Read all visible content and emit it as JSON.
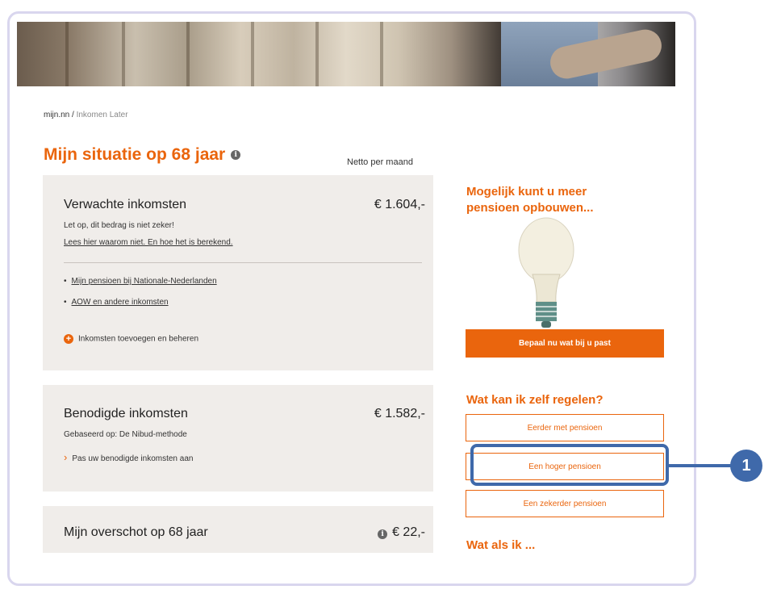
{
  "breadcrumb": {
    "root": "mijn.nn",
    "separator": " / ",
    "current": "Inkomen Later"
  },
  "page": {
    "title": "Mijn situatie op 68 jaar",
    "column_label": "Netto per maand"
  },
  "expected_income": {
    "title": "Verwachte inkomsten",
    "amount": "€ 1.604,-",
    "note": "Let op, dit bedrag is niet zeker!",
    "explain_link": "Lees hier waarom niet. En hoe het is berekend.",
    "links": [
      "Mijn pensioen bij Nationale-Nederlanden",
      "AOW en andere inkomsten"
    ],
    "add_label": "Inkomsten toevoegen en beheren"
  },
  "needed_income": {
    "title": "Benodigde inkomsten",
    "amount": "€ 1.582,-",
    "basis": "Gebaseerd op: De Nibud-methode",
    "adjust_link": "Pas uw benodigde inkomsten aan"
  },
  "surplus": {
    "title": "Mijn overschot op 68 jaar",
    "amount": "€ 22,-"
  },
  "sidebar": {
    "promo_heading": "Mogelijk kunt u meer pensioen opbouwen...",
    "cta_label": "Bepaal nu wat bij u past",
    "regelen_heading": "Wat kan ik zelf regelen?",
    "options": [
      "Eerder met pensioen",
      "Een hoger pensioen",
      "Een zekerder pensioen"
    ],
    "what_if_heading": "Wat als ik ..."
  },
  "callout": {
    "number": "1"
  },
  "colors": {
    "accent": "#ea650d",
    "callout": "#3f69aa",
    "card_bg": "#f0edea"
  }
}
